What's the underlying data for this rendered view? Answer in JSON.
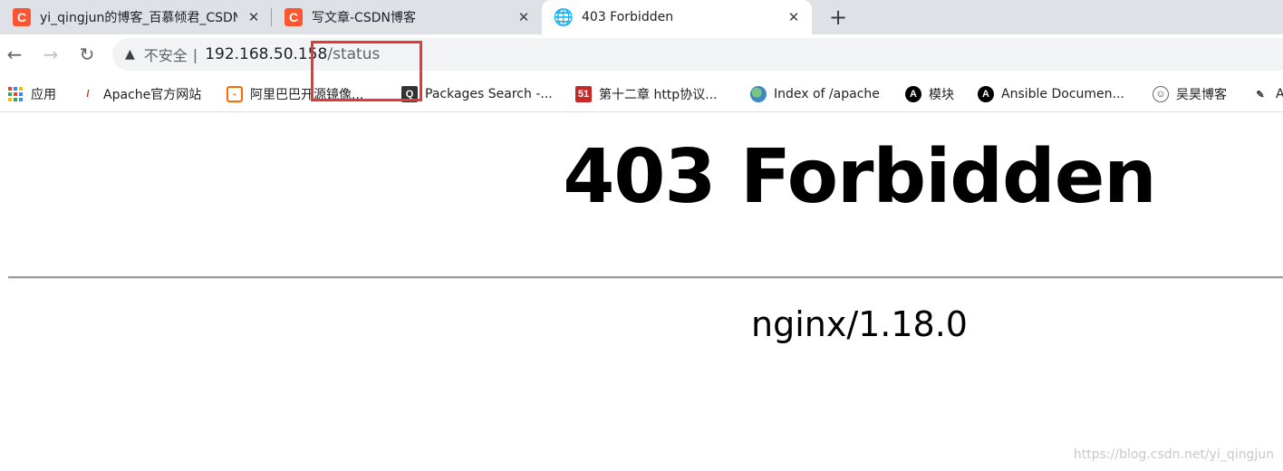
{
  "tabs": [
    {
      "title": "yi_qingjun的博客_百慕倾君_CSDN博客",
      "favicon": "C",
      "close": "✕"
    },
    {
      "title": "写文章-CSDN博客",
      "favicon": "C",
      "close": "✕"
    },
    {
      "title": "403 Forbidden",
      "favicon": "🌐",
      "close": "✕",
      "active": true
    }
  ],
  "new_tab": "+",
  "toolbar": {
    "back": "←",
    "forward": "→",
    "reload": "↻",
    "warning_icon": "▲",
    "security_label": "不安全",
    "separator": "|",
    "url_host": "192.168.50.158",
    "url_path": "/status"
  },
  "bookmarks": [
    {
      "label": "应用",
      "icon": "apps-grid-icon"
    },
    {
      "label": "Apache官方网站",
      "icon": "apache-feather-icon"
    },
    {
      "label": "阿里巴巴开源镜像...",
      "icon": "aliyun-icon"
    },
    {
      "label": "Packages Search -...",
      "icon": "search-icon"
    },
    {
      "label": "第十二章 http协议...",
      "icon": "51cto-icon"
    },
    {
      "label": "Index of /apache",
      "icon": "globe-icon"
    },
    {
      "label": "模块",
      "icon": "ansible-icon"
    },
    {
      "label": "Ansible Documen...",
      "icon": "ansible-icon"
    },
    {
      "label": "吴昊博客",
      "icon": "avatar-icon"
    },
    {
      "label": "A",
      "icon": "pen-icon"
    }
  ],
  "content": {
    "heading": "403 Forbidden",
    "server": "nginx/1.18.0"
  },
  "watermark": "https://blog.csdn.net/yi_qingjun",
  "colors": {
    "tabstrip_bg": "#dee1e6",
    "csdn_orange": "#fc5531",
    "annotation_red": "#e53935"
  }
}
